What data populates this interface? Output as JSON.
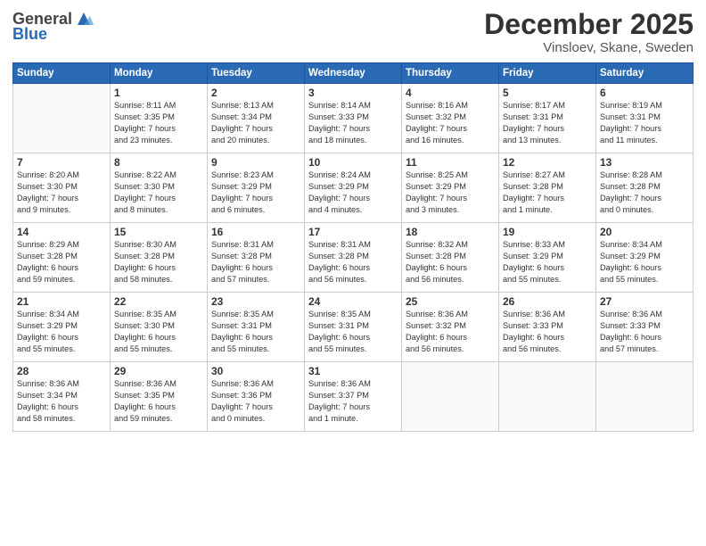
{
  "header": {
    "logo_general": "General",
    "logo_blue": "Blue",
    "month": "December 2025",
    "location": "Vinsloev, Skane, Sweden"
  },
  "weekdays": [
    "Sunday",
    "Monday",
    "Tuesday",
    "Wednesday",
    "Thursday",
    "Friday",
    "Saturday"
  ],
  "weeks": [
    [
      {
        "day": "",
        "info": ""
      },
      {
        "day": "1",
        "info": "Sunrise: 8:11 AM\nSunset: 3:35 PM\nDaylight: 7 hours\nand 23 minutes."
      },
      {
        "day": "2",
        "info": "Sunrise: 8:13 AM\nSunset: 3:34 PM\nDaylight: 7 hours\nand 20 minutes."
      },
      {
        "day": "3",
        "info": "Sunrise: 8:14 AM\nSunset: 3:33 PM\nDaylight: 7 hours\nand 18 minutes."
      },
      {
        "day": "4",
        "info": "Sunrise: 8:16 AM\nSunset: 3:32 PM\nDaylight: 7 hours\nand 16 minutes."
      },
      {
        "day": "5",
        "info": "Sunrise: 8:17 AM\nSunset: 3:31 PM\nDaylight: 7 hours\nand 13 minutes."
      },
      {
        "day": "6",
        "info": "Sunrise: 8:19 AM\nSunset: 3:31 PM\nDaylight: 7 hours\nand 11 minutes."
      }
    ],
    [
      {
        "day": "7",
        "info": "Sunrise: 8:20 AM\nSunset: 3:30 PM\nDaylight: 7 hours\nand 9 minutes."
      },
      {
        "day": "8",
        "info": "Sunrise: 8:22 AM\nSunset: 3:30 PM\nDaylight: 7 hours\nand 8 minutes."
      },
      {
        "day": "9",
        "info": "Sunrise: 8:23 AM\nSunset: 3:29 PM\nDaylight: 7 hours\nand 6 minutes."
      },
      {
        "day": "10",
        "info": "Sunrise: 8:24 AM\nSunset: 3:29 PM\nDaylight: 7 hours\nand 4 minutes."
      },
      {
        "day": "11",
        "info": "Sunrise: 8:25 AM\nSunset: 3:29 PM\nDaylight: 7 hours\nand 3 minutes."
      },
      {
        "day": "12",
        "info": "Sunrise: 8:27 AM\nSunset: 3:28 PM\nDaylight: 7 hours\nand 1 minute."
      },
      {
        "day": "13",
        "info": "Sunrise: 8:28 AM\nSunset: 3:28 PM\nDaylight: 7 hours\nand 0 minutes."
      }
    ],
    [
      {
        "day": "14",
        "info": "Sunrise: 8:29 AM\nSunset: 3:28 PM\nDaylight: 6 hours\nand 59 minutes."
      },
      {
        "day": "15",
        "info": "Sunrise: 8:30 AM\nSunset: 3:28 PM\nDaylight: 6 hours\nand 58 minutes."
      },
      {
        "day": "16",
        "info": "Sunrise: 8:31 AM\nSunset: 3:28 PM\nDaylight: 6 hours\nand 57 minutes."
      },
      {
        "day": "17",
        "info": "Sunrise: 8:31 AM\nSunset: 3:28 PM\nDaylight: 6 hours\nand 56 minutes."
      },
      {
        "day": "18",
        "info": "Sunrise: 8:32 AM\nSunset: 3:28 PM\nDaylight: 6 hours\nand 56 minutes."
      },
      {
        "day": "19",
        "info": "Sunrise: 8:33 AM\nSunset: 3:29 PM\nDaylight: 6 hours\nand 55 minutes."
      },
      {
        "day": "20",
        "info": "Sunrise: 8:34 AM\nSunset: 3:29 PM\nDaylight: 6 hours\nand 55 minutes."
      }
    ],
    [
      {
        "day": "21",
        "info": "Sunrise: 8:34 AM\nSunset: 3:29 PM\nDaylight: 6 hours\nand 55 minutes."
      },
      {
        "day": "22",
        "info": "Sunrise: 8:35 AM\nSunset: 3:30 PM\nDaylight: 6 hours\nand 55 minutes."
      },
      {
        "day": "23",
        "info": "Sunrise: 8:35 AM\nSunset: 3:31 PM\nDaylight: 6 hours\nand 55 minutes."
      },
      {
        "day": "24",
        "info": "Sunrise: 8:35 AM\nSunset: 3:31 PM\nDaylight: 6 hours\nand 55 minutes."
      },
      {
        "day": "25",
        "info": "Sunrise: 8:36 AM\nSunset: 3:32 PM\nDaylight: 6 hours\nand 56 minutes."
      },
      {
        "day": "26",
        "info": "Sunrise: 8:36 AM\nSunset: 3:33 PM\nDaylight: 6 hours\nand 56 minutes."
      },
      {
        "day": "27",
        "info": "Sunrise: 8:36 AM\nSunset: 3:33 PM\nDaylight: 6 hours\nand 57 minutes."
      }
    ],
    [
      {
        "day": "28",
        "info": "Sunrise: 8:36 AM\nSunset: 3:34 PM\nDaylight: 6 hours\nand 58 minutes."
      },
      {
        "day": "29",
        "info": "Sunrise: 8:36 AM\nSunset: 3:35 PM\nDaylight: 6 hours\nand 59 minutes."
      },
      {
        "day": "30",
        "info": "Sunrise: 8:36 AM\nSunset: 3:36 PM\nDaylight: 7 hours\nand 0 minutes."
      },
      {
        "day": "31",
        "info": "Sunrise: 8:36 AM\nSunset: 3:37 PM\nDaylight: 7 hours\nand 1 minute."
      },
      {
        "day": "",
        "info": ""
      },
      {
        "day": "",
        "info": ""
      },
      {
        "day": "",
        "info": ""
      }
    ]
  ]
}
